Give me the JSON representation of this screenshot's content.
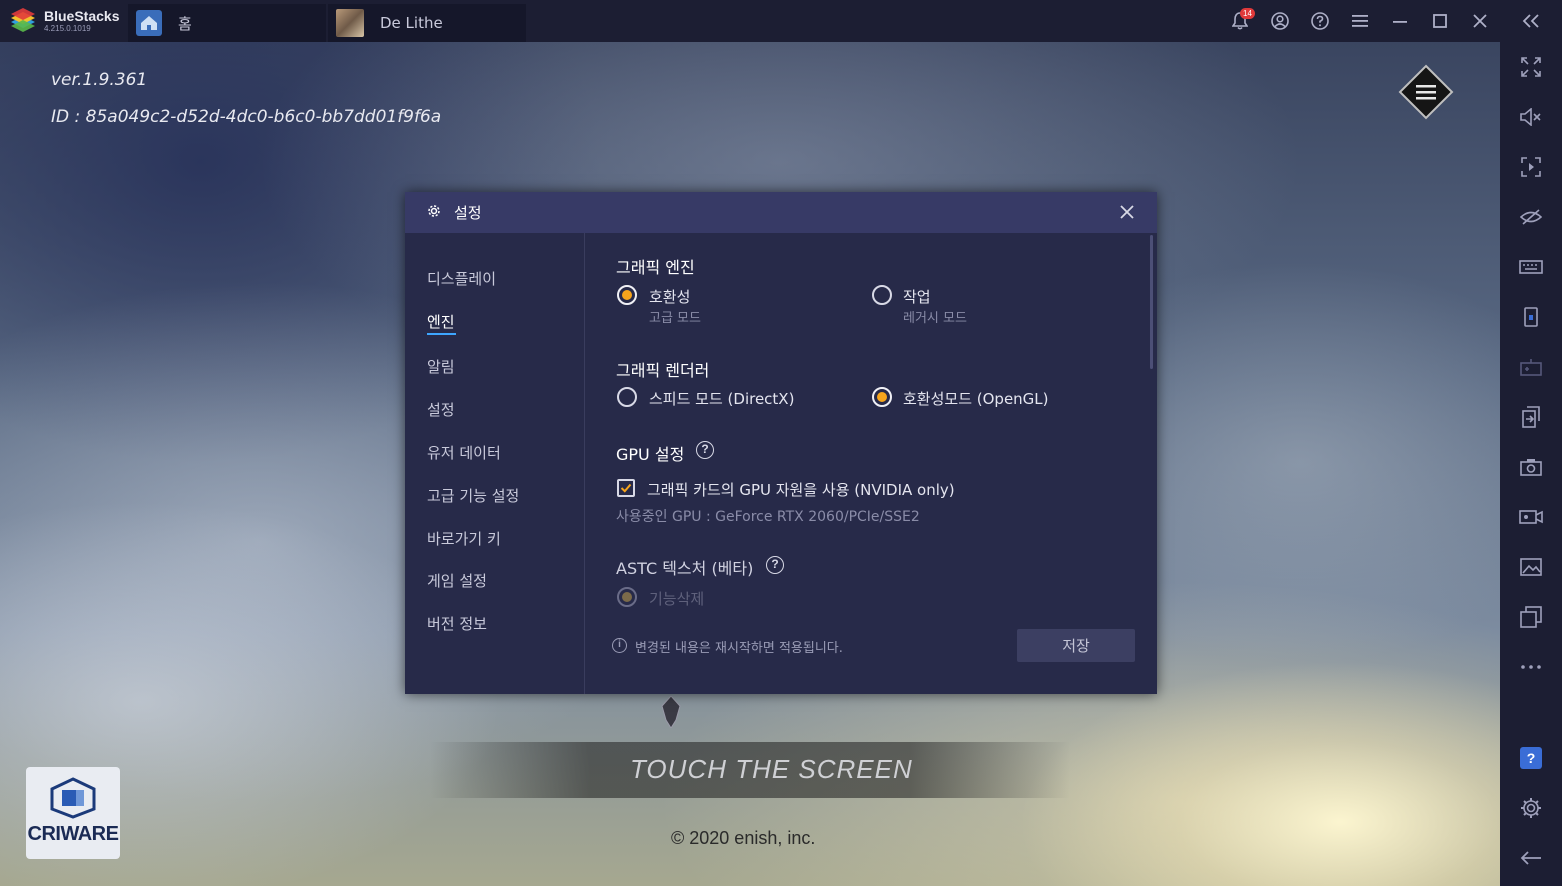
{
  "titlebar": {
    "brand_name": "BlueStacks",
    "brand_version": "4.215.0.1019",
    "tabs": [
      {
        "label": "홈",
        "icon": "home-icon"
      },
      {
        "label": "De Lithe",
        "icon": "game-thumbnail"
      }
    ],
    "notification_count": "14",
    "icons": [
      "bell-icon",
      "account-icon",
      "help-icon",
      "menu-icon",
      "minimize-icon",
      "maximize-icon",
      "close-icon",
      "collapse-sidebar-icon"
    ]
  },
  "game": {
    "version": "ver.1.9.361",
    "id": "ID : 85a049c2-d52d-4dc0-b6c0-bb7dd01f9f6a",
    "touch_text": "TOUCH THE SCREEN",
    "copyright": "© 2020 enish, inc.",
    "middleware_logo": "CRIWARE"
  },
  "sidebar": {
    "icons": [
      "fullscreen-icon",
      "volume-mute-icon",
      "screen-rotate-icon",
      "eye-off-icon",
      "keyboard-icon",
      "phone-icon",
      "gamepad-icon",
      "apk-install-icon",
      "screenshot-icon",
      "video-record-icon",
      "media-folder-icon",
      "multi-instance-icon",
      "more-icon"
    ],
    "help_label": "?",
    "bottom_icons": [
      "settings-gear-icon",
      "back-arrow-icon"
    ]
  },
  "dialog": {
    "title": "설정",
    "nav": [
      {
        "label": "디스플레이",
        "active": false
      },
      {
        "label": "엔진",
        "active": true
      },
      {
        "label": "알림",
        "active": false
      },
      {
        "label": "설정",
        "active": false
      },
      {
        "label": "유저 데이터",
        "active": false
      },
      {
        "label": "고급 기능 설정",
        "active": false
      },
      {
        "label": "바로가기 키",
        "active": false
      },
      {
        "label": "게임 설정",
        "active": false
      },
      {
        "label": "버전 정보",
        "active": false
      }
    ],
    "graphics_engine": {
      "title": "그래픽 엔진",
      "options": [
        {
          "label": "호환성",
          "sub": "고급 모드",
          "selected": true
        },
        {
          "label": "작업",
          "sub": "레거시 모드",
          "selected": false
        }
      ]
    },
    "graphics_renderer": {
      "title": "그래픽 렌더러",
      "options": [
        {
          "label": "스피드 모드 (DirectX)",
          "selected": false
        },
        {
          "label": "호환성모드 (OpenGL)",
          "selected": true
        }
      ]
    },
    "gpu": {
      "title": "GPU 설정",
      "checkbox_label": "그래픽 카드의 GPU 자원을 사용 (NVIDIA only)",
      "checked": true,
      "in_use": "사용중인 GPU : GeForce RTX 2060/PCIe/SSE2"
    },
    "astc": {
      "title": "ASTC 텍스처 (베타)",
      "option_label": "기능삭제",
      "disabled": true
    },
    "footer_note": "변경된 내용은 재시작하면 적용됩니다.",
    "save_label": "저장",
    "colors": {
      "accent": "#f7a51c",
      "header": "#373a66",
      "panel": "#272a49",
      "active_underline": "#3ea6ff"
    }
  }
}
